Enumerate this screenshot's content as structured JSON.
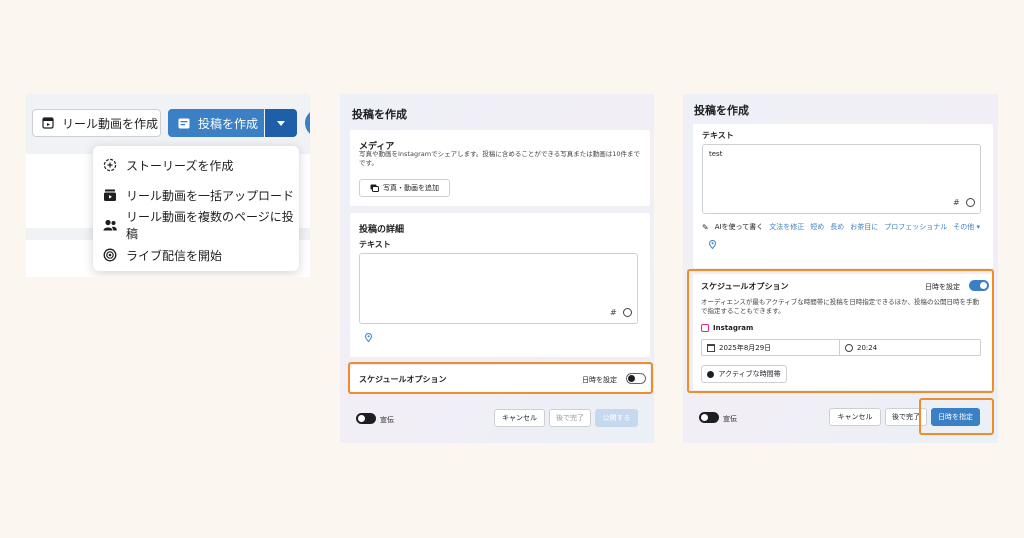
{
  "panel1": {
    "reel_button": "リール動画を作成",
    "post_button": "投稿を作成",
    "menu": [
      {
        "icon": "story-plus-icon",
        "label": "ストーリーズを作成"
      },
      {
        "icon": "bulk-upload-icon",
        "label": "リール動画を一括アップロード"
      },
      {
        "icon": "multi-page-icon",
        "label": "リール動画を複数のページに投稿"
      },
      {
        "icon": "live-icon",
        "label": "ライブ配信を開始"
      }
    ]
  },
  "panel2": {
    "title": "投稿を作成",
    "media_label": "メディア",
    "media_desc": "写真や動画をInstagramでシェアします。投稿に含めることができる写真または動画は10件までです。",
    "add_media_button": "写真・動画を追加",
    "details_label": "投稿の詳細",
    "text_label": "テキスト",
    "hash": "#",
    "schedule_label": "スケジュールオプション",
    "schedule_toggle_label": "日時を設定",
    "promo_label": "宣伝",
    "cancel": "キャンセル",
    "later": "後で完了",
    "publish": "公開する"
  },
  "panel3": {
    "title": "投稿を作成",
    "text_label": "テキスト",
    "text_value": "test",
    "hash": "#",
    "ai_items": [
      "AIを使って書く",
      "文法を修正",
      "短め",
      "長め",
      "お茶目に",
      "プロフェッショナル",
      "その他"
    ],
    "schedule_label": "スケジュールオプション",
    "schedule_toggle_label": "日時を設定",
    "schedule_desc": "オーディエンスが最もアクティブな時間帯に投稿を日時指定できるほか、投稿の公開日時を手動で指定することもできます。",
    "platform": "Instagram",
    "date": "2025年8月29日",
    "time": "20:24",
    "active_times_button": "アクティブな時間帯",
    "promo_label": "宣伝",
    "cancel": "キャンセル",
    "later": "後で完了",
    "schedule_button": "日時を指定"
  },
  "colors": {
    "accent": "#3b7fc4",
    "highlight": "#f08c2a",
    "background": "#fbf6ef"
  }
}
